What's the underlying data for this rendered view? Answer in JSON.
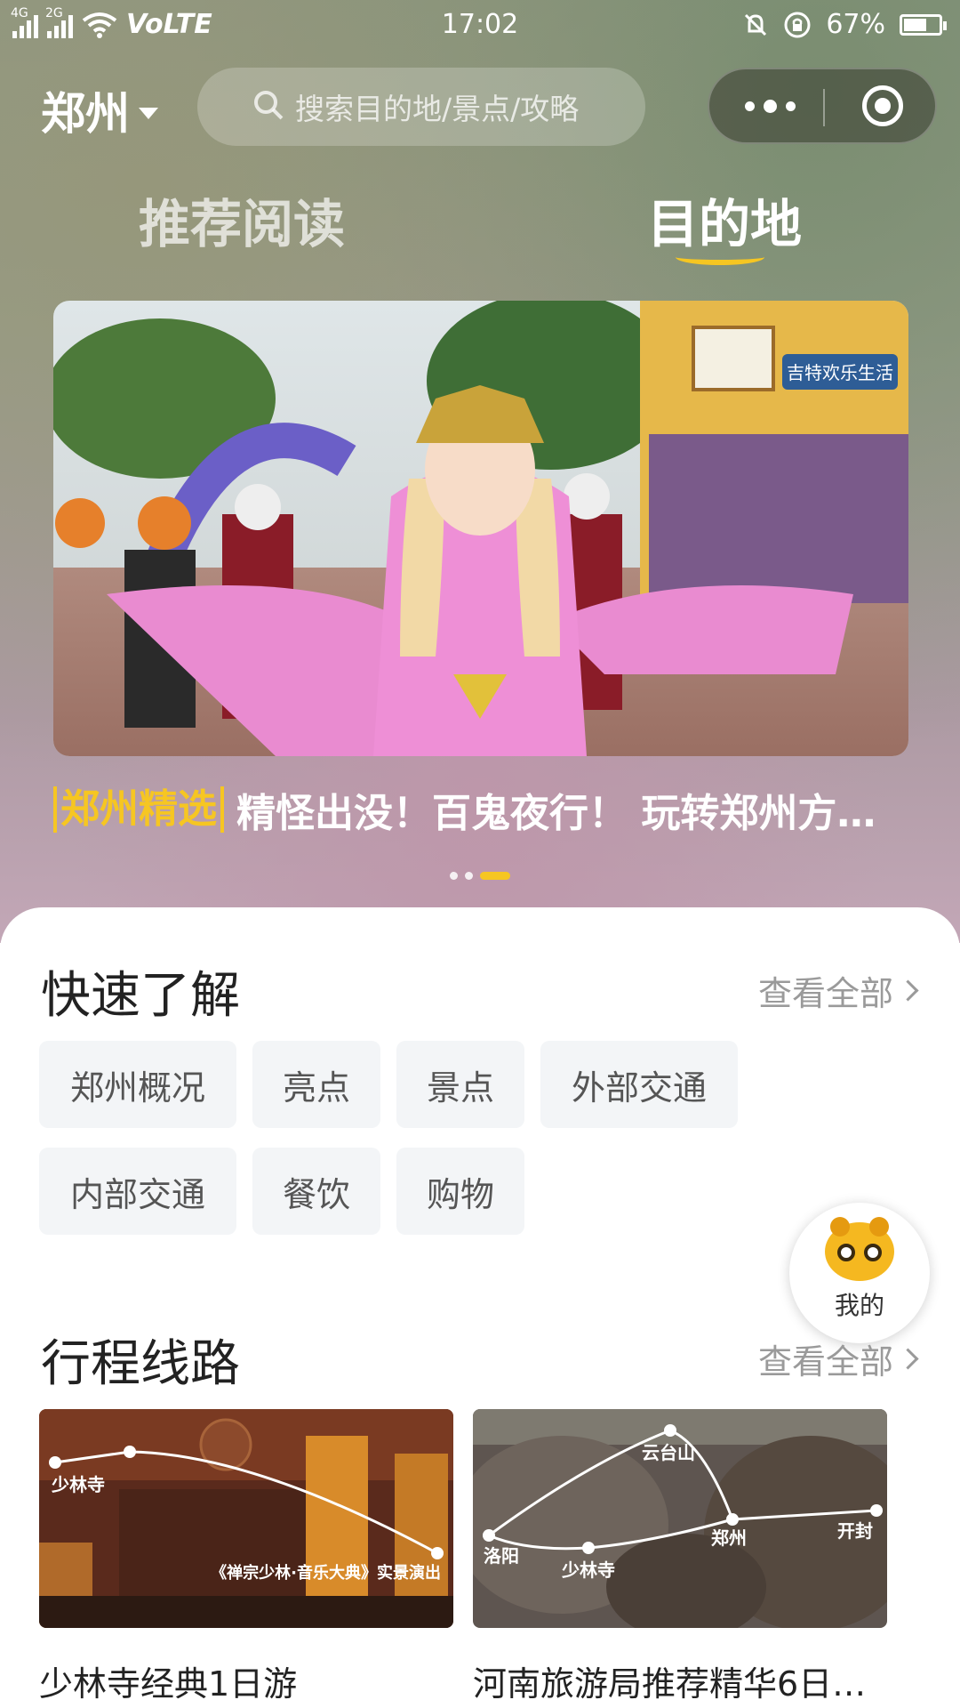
{
  "status_bar": {
    "network_left": "4G",
    "network_right": "2G",
    "volte": "VoLTE",
    "time": "17:02",
    "battery": "67%",
    "battery_level": 0.67
  },
  "header": {
    "city": "郑州",
    "search_placeholder": "搜索目的地/景点/攻略"
  },
  "tabs": [
    {
      "label": "推荐阅读",
      "active": false
    },
    {
      "label": "目的地",
      "active": true
    }
  ],
  "banner": {
    "tag": "郑州精选",
    "title": "精怪出没！百鬼夜行！ 玩转郑州方…",
    "sign_text": "吉特欢乐生活",
    "page_index": 3,
    "page_count": 3
  },
  "quick": {
    "title": "快速了解",
    "see_all": "查看全部",
    "chips": [
      "郑州概况",
      "亮点",
      "景点",
      "外部交通",
      "内部交通",
      "餐饮",
      "购物"
    ]
  },
  "floating": {
    "label": "我的"
  },
  "routes": {
    "title": "行程线路",
    "see_all": "查看全部",
    "items": [
      {
        "title": "少林寺经典1日游",
        "map_labels": [
          "少林寺",
          "《禅宗少林·音乐大典》实景演出"
        ]
      },
      {
        "title": "河南旅游局推荐精华6日…",
        "map_labels": [
          "云台山",
          "洛阳",
          "少林寺",
          "郑州",
          "开封"
        ]
      }
    ]
  },
  "colors": {
    "accent": "#f6c622",
    "chip_bg": "#f3f5f7",
    "muted_text": "#9a9a9a"
  }
}
